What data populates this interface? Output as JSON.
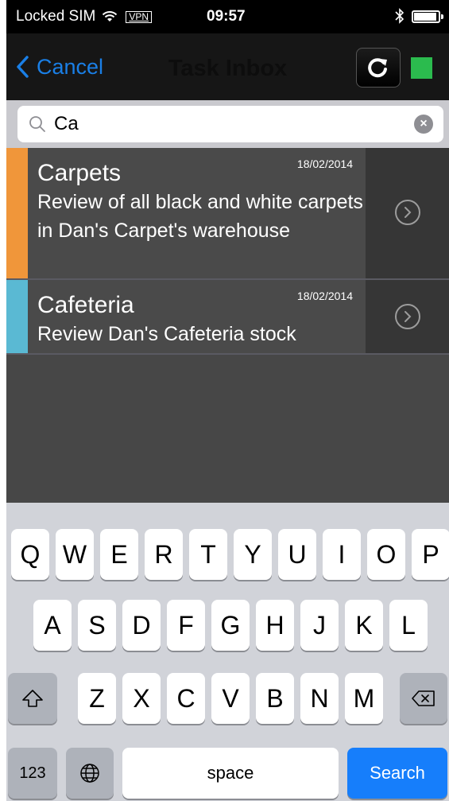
{
  "status_bar": {
    "carrier": "Locked SIM",
    "vpn": "VPN",
    "time": "09:57"
  },
  "nav": {
    "back_label": "Cancel",
    "title": "Task Inbox",
    "sync_status_color": "#2bbb4e"
  },
  "search": {
    "value": "Ca",
    "icon": "magnifier-icon",
    "clear_icon": "clear-x-icon"
  },
  "tasks": [
    {
      "title": "Carpets",
      "description": "Review of all black and white carpets in Dan's Carpet's warehouse",
      "date": "18/02/2014",
      "color": "#f0963a"
    },
    {
      "title": "Cafeteria",
      "description": "Review Dan's Cafeteria stock",
      "date": "18/02/2014",
      "color": "#5ab9d3"
    }
  ],
  "keyboard": {
    "row1": [
      "Q",
      "W",
      "E",
      "R",
      "T",
      "Y",
      "U",
      "I",
      "O",
      "P"
    ],
    "row2": [
      "A",
      "S",
      "D",
      "F",
      "G",
      "H",
      "J",
      "K",
      "L"
    ],
    "row3": [
      "Z",
      "X",
      "C",
      "V",
      "B",
      "N",
      "M"
    ],
    "numbers_label": "123",
    "space_label": "space",
    "search_label": "Search"
  },
  "colors": {
    "accent_blue": "#1a7fe6",
    "search_key_blue": "#167efb"
  }
}
